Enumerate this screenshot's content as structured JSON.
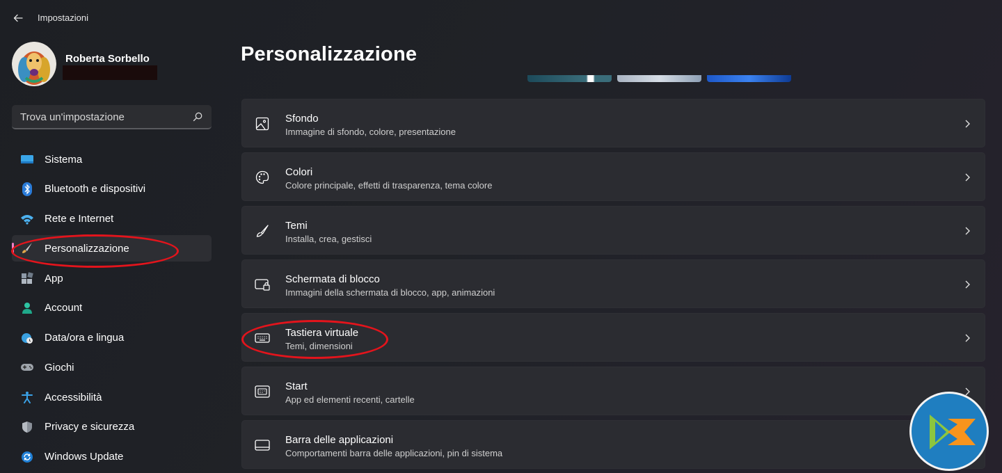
{
  "window": {
    "title": "Impostazioni"
  },
  "profile": {
    "name": "Roberta Sorbello"
  },
  "search": {
    "placeholder": "Trova un'impostazione"
  },
  "sidebar": {
    "items": [
      {
        "label": "Sistema",
        "icon": "system-icon",
        "active": false
      },
      {
        "label": "Bluetooth e dispositivi",
        "icon": "bluetooth-icon",
        "active": false
      },
      {
        "label": "Rete e Internet",
        "icon": "wifi-icon",
        "active": false
      },
      {
        "label": "Personalizzazione",
        "icon": "brush-icon",
        "active": true
      },
      {
        "label": "App",
        "icon": "apps-icon",
        "active": false
      },
      {
        "label": "Account",
        "icon": "account-icon",
        "active": false
      },
      {
        "label": "Data/ora e lingua",
        "icon": "globe-clock-icon",
        "active": false
      },
      {
        "label": "Giochi",
        "icon": "gamepad-icon",
        "active": false
      },
      {
        "label": "Accessibilità",
        "icon": "accessibility-icon",
        "active": false
      },
      {
        "label": "Privacy e sicurezza",
        "icon": "shield-icon",
        "active": false
      },
      {
        "label": "Windows Update",
        "icon": "update-icon",
        "active": false
      }
    ]
  },
  "main": {
    "title": "Personalizzazione",
    "cards": [
      {
        "title": "Sfondo",
        "description": "Immagine di sfondo, colore, presentazione",
        "icon": "picture-icon"
      },
      {
        "title": "Colori",
        "description": "Colore principale, effetti di trasparenza, tema colore",
        "icon": "palette-icon"
      },
      {
        "title": "Temi",
        "description": "Installa, crea, gestisci",
        "icon": "brush-icon"
      },
      {
        "title": "Schermata di blocco",
        "description": "Immagini della schermata di blocco, app, animazioni",
        "icon": "lock-screen-icon"
      },
      {
        "title": "Tastiera virtuale",
        "description": "Temi, dimensioni",
        "icon": "keyboard-icon"
      },
      {
        "title": "Start",
        "description": "App ed elementi recenti, cartelle",
        "icon": "start-icon"
      },
      {
        "title": "Barra delle applicazioni",
        "description": "Comportamenti barra delle applicazioni, pin di sistema",
        "icon": "taskbar-icon"
      }
    ]
  },
  "colors": {
    "accent": "#f17fc4",
    "annotation": "#e3141c",
    "card_bg": "#2b2c31",
    "logo_bg": "#1f7ec0"
  }
}
